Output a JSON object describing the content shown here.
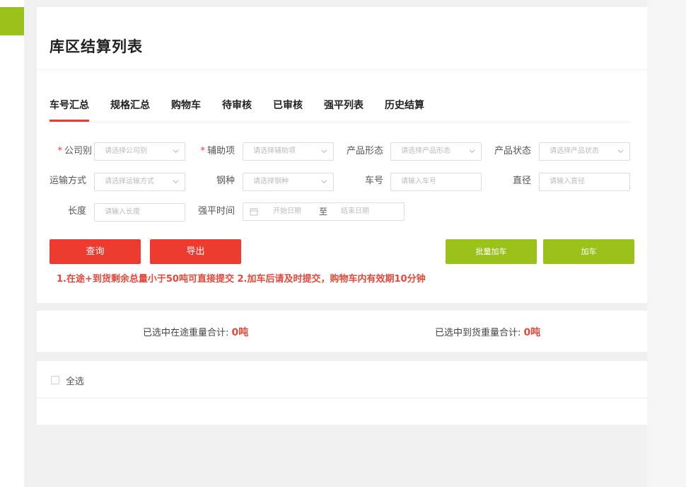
{
  "page_title": "库区结算列表",
  "tabs": [
    {
      "label": "车号汇总",
      "active": true
    },
    {
      "label": "规格汇总",
      "active": false
    },
    {
      "label": "购物车",
      "active": false
    },
    {
      "label": "待审核",
      "active": false
    },
    {
      "label": "已审核",
      "active": false
    },
    {
      "label": "强平列表",
      "active": false
    },
    {
      "label": "历史结算",
      "active": false
    }
  ],
  "filters": {
    "company": {
      "label": "公司别",
      "required_mark": "*",
      "placeholder": "请选择公司别"
    },
    "aux_item": {
      "label": "辅助项",
      "required_mark": "*",
      "placeholder": "请选择辅助项"
    },
    "product_form": {
      "label": "产品形态",
      "placeholder": "请选择产品形态"
    },
    "product_status": {
      "label": "产品状态",
      "placeholder": "请选择产品状态"
    },
    "transport": {
      "label": "运输方式",
      "placeholder": "请选择运输方式"
    },
    "steel_type": {
      "label": "钢种",
      "placeholder": "请选择钢种"
    },
    "car_no": {
      "label": "车号",
      "placeholder": "请输入车号"
    },
    "diameter": {
      "label": "直径",
      "placeholder": "请输入直径"
    },
    "length": {
      "label": "长度",
      "placeholder": "请输入长度"
    },
    "force_time": {
      "label": "强平时间",
      "start_placeholder": "开始日期",
      "separator": "至",
      "end_placeholder": "结束日期"
    }
  },
  "buttons": {
    "query": "查询",
    "export": "导出",
    "batch_add": "批量加车",
    "add": "加车"
  },
  "notice": "1.在途+到货剩余总量小于50吨可直接提交 2.加车后请及时提交，购物车内有效期10分钟",
  "summary": {
    "in_transit_label": "已选中在途重量合计:",
    "in_transit_value": "0吨",
    "arrived_label": "已选中到货重量合计:",
    "arrived_value": "0吨"
  },
  "list": {
    "select_all": "全选"
  },
  "colors": {
    "accent_green": "#9bc21a",
    "primary_red": "#ee3b30",
    "notice_red": "#e4483a"
  }
}
